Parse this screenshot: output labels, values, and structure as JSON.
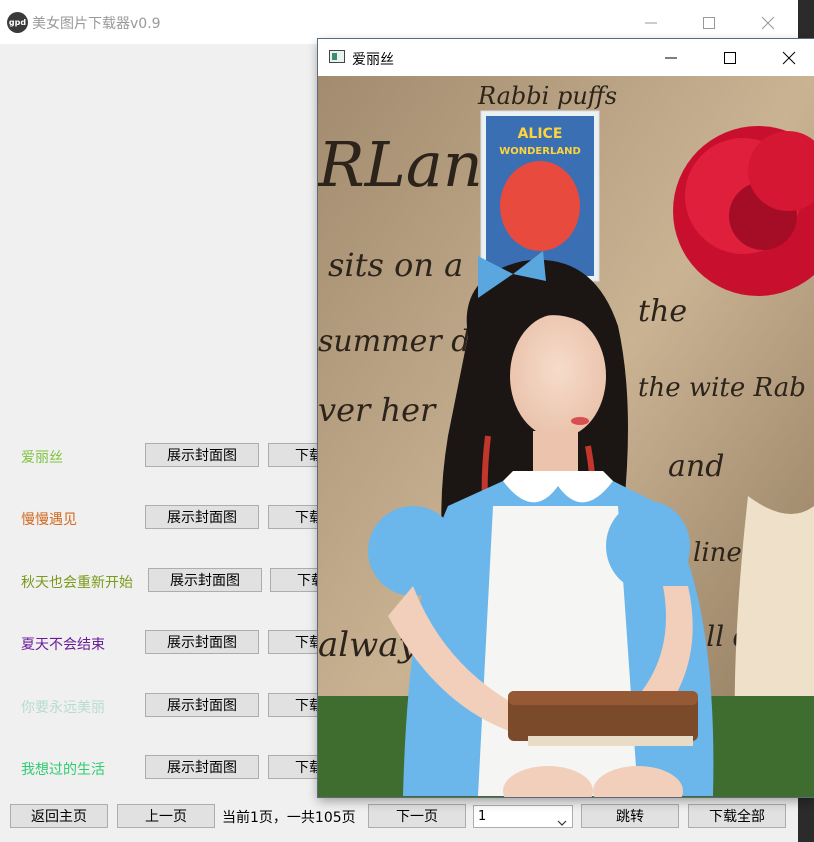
{
  "main_window": {
    "title": "美女图片下载器v0.9",
    "app_icon_text": "gpd"
  },
  "rows": [
    {
      "title": "爱丽丝",
      "color": "#7ec23c",
      "show_label": "展示封面图",
      "download_label": "下载"
    },
    {
      "title": "慢慢遇见",
      "color": "#d2691e",
      "show_label": "展示封面图",
      "download_label": "下载"
    },
    {
      "title": "秋天也会重新开始",
      "color": "#7a9a1a",
      "show_label": "展示封面图",
      "download_label": "下载"
    },
    {
      "title": "夏天不会结束",
      "color": "#6a1b9a",
      "show_label": "展示封面图",
      "download_label": "下载"
    },
    {
      "title": "你要永远美丽",
      "color": "#b7dccf",
      "show_label": "展示封面图",
      "download_label": "下载"
    },
    {
      "title": "我想过的生活",
      "color": "#2ecc71",
      "show_label": "展示封面图",
      "download_label": "下载"
    }
  ],
  "footer": {
    "home_label": "返回主页",
    "prev_label": "上一页",
    "page_info": "当前1页，一共105页",
    "next_label": "下一页",
    "page_select_value": "1",
    "jump_label": "跳转",
    "download_all_label": "下载全部"
  },
  "popup": {
    "title": "爱丽丝"
  },
  "photo_text": {
    "poster_alice": "ALICE",
    "poster_wonderland": "WONDERLAND",
    "wall_rland": "RLand",
    "wall_rabbit": "Rabbi puffs",
    "wall_sits": "sits on a",
    "wall_summer": "summer day",
    "wall_her": "ver her",
    "wall_the": "the",
    "wall_white": "the wite Rab",
    "wall_and": "and",
    "wall_always": "always",
    "wall_small": "mall doo",
    "wall_lined": "lined w"
  }
}
